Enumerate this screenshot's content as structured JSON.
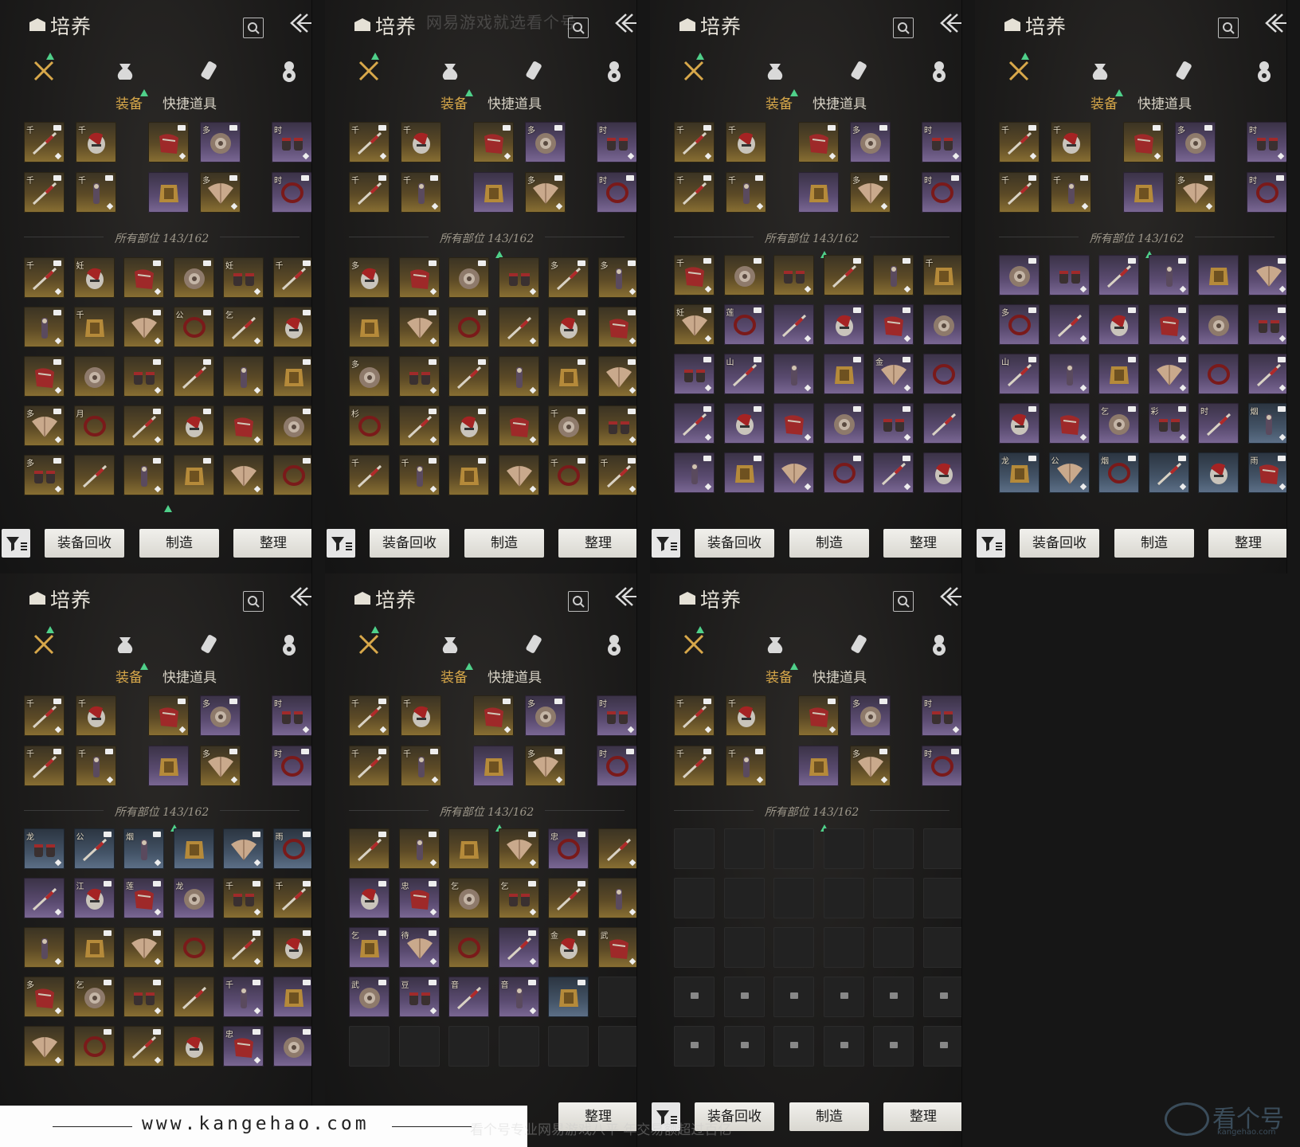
{
  "header": {
    "title": "培养",
    "search_icon": "search-icon",
    "back_icon": "collapse-arrow-icon"
  },
  "categories": [
    {
      "icon": "crossed-swords-icon",
      "has_new": true
    },
    {
      "icon": "pouch-icon",
      "has_new": false
    },
    {
      "icon": "scroll-icon",
      "has_new": false
    },
    {
      "icon": "gourd-icon",
      "has_new": false
    }
  ],
  "subtabs": {
    "equipment": "装备",
    "quick_items": "快捷道具"
  },
  "equipped_label": "所有部位 143/162",
  "buttons": {
    "recycle": "装备回收",
    "craft": "制造",
    "sort": "整理"
  },
  "colors": {
    "accent": "#d8a84a",
    "new_marker": "#4fd08a",
    "gold_rarity": "#8a7033",
    "purple_rarity": "#7b6895",
    "blue_rarity": "#5d7088"
  },
  "equipped_slots": {
    "row1": [
      {
        "char": "千",
        "rarity": "gold",
        "icon": "spear-icon"
      },
      {
        "char": "千",
        "rarity": "gold",
        "icon": "spear-icon"
      },
      {
        "char": "",
        "rarity": "gold",
        "icon": "helmet-icon"
      },
      {
        "char": "多",
        "rarity": "purple",
        "icon": "cloak-icon"
      },
      {
        "char": "时",
        "rarity": "purple",
        "icon": "hairpin-icon"
      }
    ],
    "row2": [
      {
        "char": "千",
        "rarity": "gold",
        "icon": "shield-icon"
      },
      {
        "char": "千",
        "rarity": "gold",
        "icon": "charm-icon"
      },
      {
        "char": "",
        "rarity": "purple",
        "icon": "bracer-icon"
      },
      {
        "char": "多",
        "rarity": "gold",
        "icon": "greave-icon"
      },
      {
        "char": "时",
        "rarity": "purple",
        "icon": "necklace-icon"
      }
    ]
  },
  "panels": [
    {
      "grid": [
        [
          "gold:千",
          "gold:妊",
          "gold:",
          "gold:",
          "gold:妊",
          "gold:千"
        ],
        [
          "gold:",
          "gold:千",
          "gold:",
          "gold:公",
          "gold:乞",
          "gold:"
        ],
        [
          "gold:",
          "gold:",
          "gold:",
          "gold:",
          "gold:",
          "gold:"
        ],
        [
          "gold:多",
          "gold:月",
          "gold:",
          "gold:",
          "gold:",
          "gold:"
        ],
        [
          "gold:多",
          "gold:",
          "gold:",
          "gold:",
          "gold:",
          "gold:"
        ]
      ]
    },
    {
      "grid": [
        [
          "gold:多",
          "gold:",
          "gold:",
          "gold:",
          "gold:多",
          "gold:多"
        ],
        [
          "gold:",
          "gold:",
          "gold:",
          "gold:",
          "gold:",
          "gold:"
        ],
        [
          "gold:多",
          "gold:",
          "gold:",
          "gold:",
          "gold:",
          "gold:"
        ],
        [
          "gold:杉",
          "gold:",
          "gold:",
          "gold:",
          "gold:千",
          "gold:"
        ],
        [
          "gold:千",
          "gold:千",
          "gold:",
          "gold:",
          "gold:千",
          "gold:千"
        ]
      ]
    },
    {
      "grid": [
        [
          "gold:千",
          "gold:",
          "gold:",
          "gold:",
          "gold:",
          "gold:千"
        ],
        [
          "gold:妊",
          "purple:莲",
          "purple:",
          "purple:",
          "purple:",
          "purple:"
        ],
        [
          "purple:",
          "purple:山",
          "purple:",
          "purple:",
          "purple:金",
          "purple:"
        ],
        [
          "purple:",
          "purple:",
          "purple:",
          "purple:",
          "purple:",
          "purple:"
        ],
        [
          "purple:",
          "purple:",
          "purple:",
          "purple:",
          "purple:",
          "purple:"
        ]
      ]
    },
    {
      "grid": [
        [
          "purple:",
          "purple:",
          "purple:",
          "purple:",
          "purple:",
          "purple:"
        ],
        [
          "purple:多",
          "purple:",
          "purple:",
          "purple:",
          "purple:",
          "purple:"
        ],
        [
          "purple:山",
          "purple:",
          "purple:",
          "purple:",
          "purple:",
          "purple:"
        ],
        [
          "purple:",
          "purple:",
          "purple:乞",
          "purple:彩",
          "purple:时",
          "blue:烟"
        ],
        [
          "blue:龙",
          "blue:公",
          "blue:烟",
          "blue:",
          "blue:",
          "blue:雨"
        ]
      ]
    },
    {
      "grid": [
        [
          "blue:龙",
          "blue:公",
          "blue:烟",
          "blue:",
          "blue:",
          "blue:雨"
        ],
        [
          "purple:",
          "purple:江",
          "purple:莲",
          "purple:龙",
          "gold:千",
          "gold:千"
        ],
        [
          "gold:",
          "gold:",
          "gold:",
          "gold:",
          "gold:",
          "gold:"
        ],
        [
          "gold:多",
          "gold:乞",
          "gold:",
          "gold:",
          "purple:千",
          "purple:"
        ],
        [
          "gold:",
          "gold:",
          "gold:",
          "gold:",
          "purple:忠",
          "purple:"
        ]
      ]
    },
    {
      "grid": [
        [
          "gold:",
          "gold:",
          "gold:",
          "gold:",
          "purple:忠",
          "gold:"
        ],
        [
          "purple:",
          "purple:忠",
          "gold:乞",
          "gold:乞",
          "gold:",
          "gold:"
        ],
        [
          "purple:乞",
          "purple:待",
          "gold:",
          "purple:",
          "gold:金",
          "gold:武"
        ],
        [
          "purple:武",
          "purple:豆",
          "purple:音",
          "purple:音",
          "blue:",
          "empty:"
        ],
        [
          "empty:",
          "empty:",
          "empty:",
          "empty:",
          "empty:",
          "empty:"
        ]
      ]
    },
    {
      "grid": [
        [
          "empty:",
          "empty:",
          "empty:",
          "empty:",
          "empty:",
          "empty:"
        ],
        [
          "empty:",
          "empty:",
          "empty:",
          "empty:",
          "empty:",
          "empty:"
        ],
        [
          "empty:",
          "empty:",
          "empty:",
          "empty:",
          "empty:",
          "empty:"
        ],
        [
          "lock:",
          "lock:",
          "lock:",
          "lock:",
          "lock:",
          "lock:"
        ],
        [
          "lock:",
          "lock:",
          "lock:",
          "lock:",
          "lock:",
          "lock:"
        ]
      ]
    }
  ],
  "watermarks": {
    "top_text": "网易游戏就选看个号",
    "footer_url": "www.kangehao.com",
    "slogan": "看个号专业网易游戏八平  年交易额超过百亿",
    "logo_text": "看个号",
    "logo_sub": "kangehao.com"
  }
}
